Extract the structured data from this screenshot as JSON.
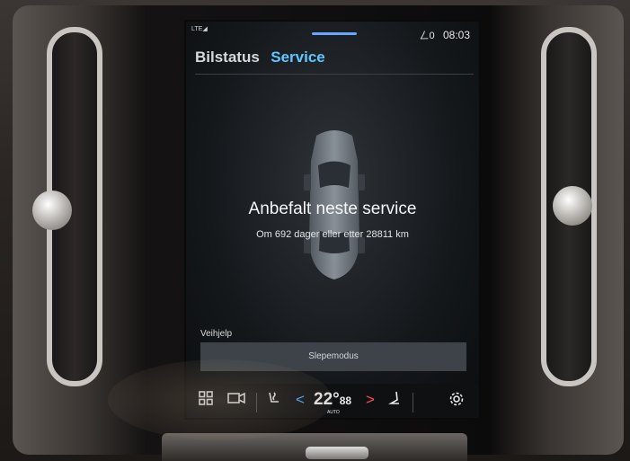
{
  "status_bar": {
    "network": "LTE◢",
    "gps_icon": "location-icon",
    "gps": "ㄥ0",
    "time": "08:03"
  },
  "tabs": [
    {
      "label": "Bilstatus",
      "active": false
    },
    {
      "label": "Service",
      "active": true
    }
  ],
  "main": {
    "headline": "Anbefalt neste service",
    "subline": "Om 692 dager eller etter 28811 km"
  },
  "assistance": {
    "label": "Veihjelp",
    "tow_mode_button": "Slepemodus"
  },
  "climate_bar": {
    "home_icon": "grid-icon",
    "camera_icon": "camera-icon",
    "seat_heat_icon": "seat-heat-icon",
    "temp_down": "<",
    "temperature": "22°",
    "fan_glyph": "88",
    "temp_mode": "AUTO",
    "temp_up": ">",
    "seat_icon": "seat-icon",
    "settings_icon": "gear-icon"
  },
  "colors": {
    "tab_active": "#5cc8ff",
    "temp_down_arrow": "#4fa8ff",
    "temp_up_arrow": "#ff4f4f",
    "button_bg": "#3d4348"
  }
}
